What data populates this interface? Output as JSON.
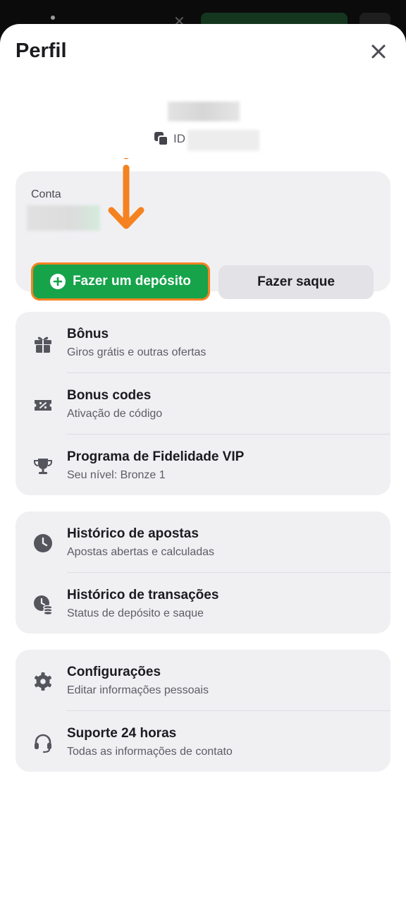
{
  "header": {
    "title": "Perfil",
    "close_icon": "close-icon"
  },
  "profile": {
    "id_label": "ID"
  },
  "account": {
    "label": "Conta",
    "deposit_label": "Fazer um depósito",
    "withdraw_label": "Fazer saque"
  },
  "menu_groups": [
    {
      "items": [
        {
          "title": "Bônus",
          "subtitle": "Giros grátis e outras ofertas",
          "icon": "gift-icon"
        },
        {
          "title": "Bonus codes",
          "subtitle": "Ativação de código",
          "icon": "coupon-icon"
        },
        {
          "title": "Programa de Fidelidade VIP",
          "subtitle": "Seu nível: Bronze 1",
          "icon": "trophy-icon"
        }
      ]
    },
    {
      "items": [
        {
          "title": "Histórico de apostas",
          "subtitle": "Apostas abertas e calculadas",
          "icon": "clock-icon"
        },
        {
          "title": "Histórico de transações",
          "subtitle": "Status de depósito e saque",
          "icon": "clock-coins-icon"
        }
      ]
    },
    {
      "items": [
        {
          "title": "Configurações",
          "subtitle": "Editar informações pessoais",
          "icon": "gear-icon"
        },
        {
          "title": "Suporte 24 horas",
          "subtitle": "Todas as informações de contato",
          "icon": "headset-icon"
        }
      ]
    }
  ],
  "colors": {
    "deposit_green": "#16a34a",
    "highlight_orange": "#f58220"
  }
}
